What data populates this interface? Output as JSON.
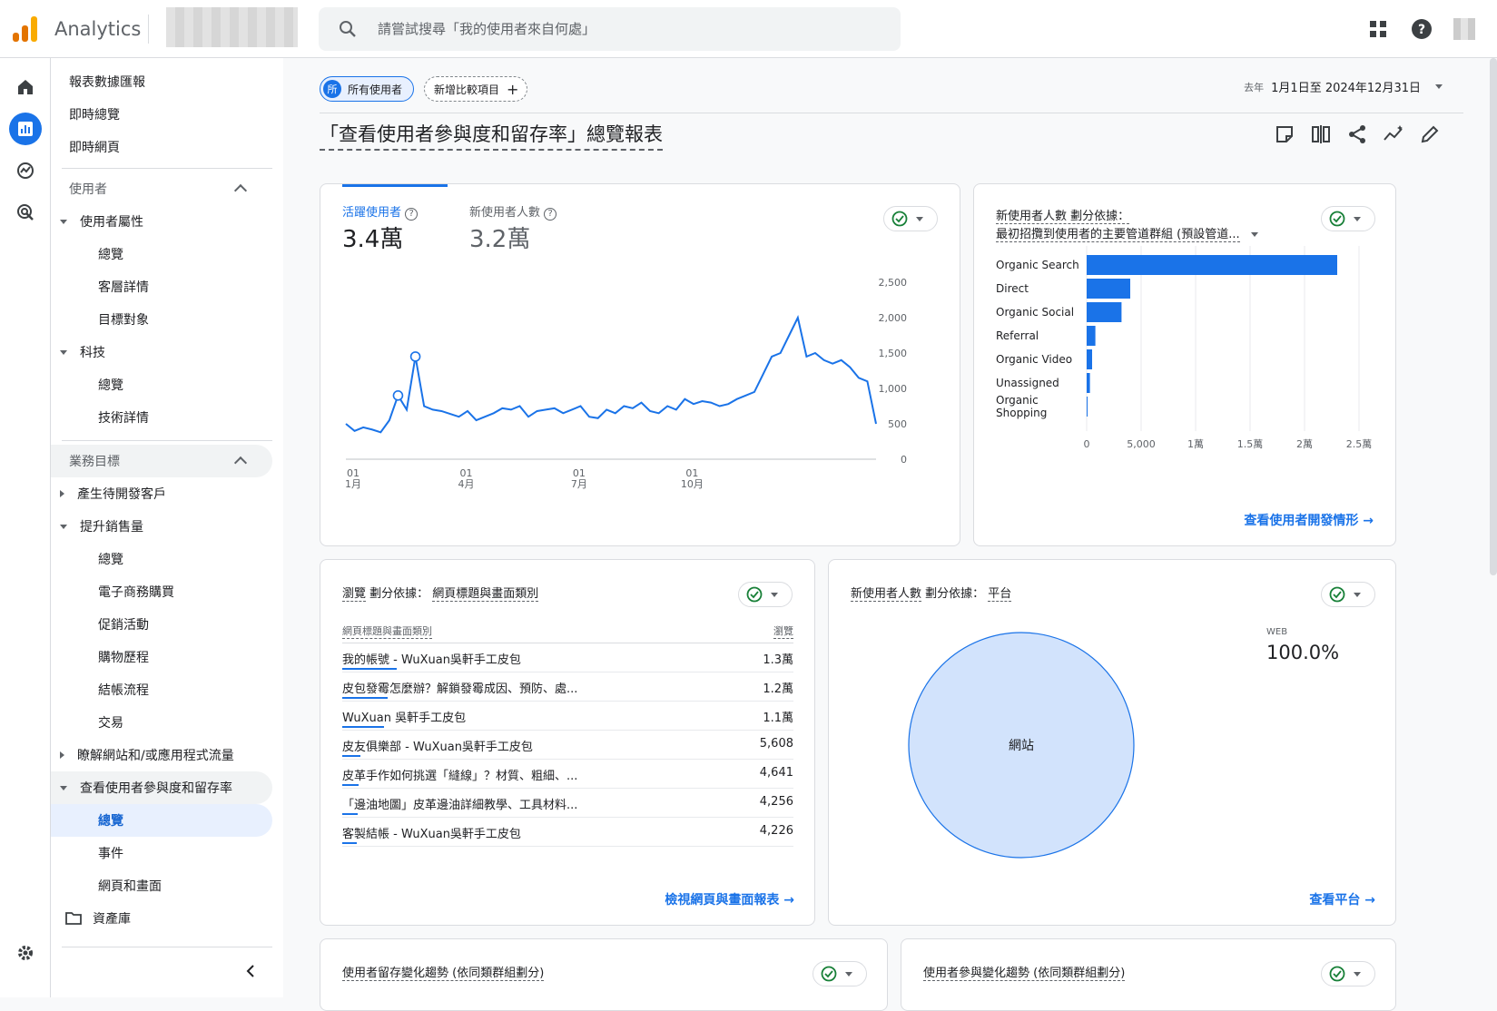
{
  "header": {
    "app_name": "Analytics",
    "search_placeholder": "請嘗試搜尋「我的使用者來自何處」"
  },
  "nav": {
    "items": [
      {
        "label": "報表數據匯報"
      },
      {
        "label": "即時總覽"
      },
      {
        "label": "即時網頁"
      }
    ],
    "section_users": "使用者",
    "user_attrs": "使用者屬性",
    "overview1": "總覽",
    "audience_detail": "客層詳情",
    "targets": "目標對象",
    "tech": "科技",
    "overview2": "總覽",
    "tech_detail": "技術詳情",
    "section_business": "業務目標",
    "leads": "產生待開發客戶",
    "sales": "提升銷售量",
    "overview3": "總覽",
    "ecom": "電子商務購買",
    "promo": "促銷活動",
    "purchase_path": "購物歷程",
    "checkout": "結帳流程",
    "transactions": "交易",
    "traffic": "瞭解網站和/或應用程式流量",
    "engagement": "查看使用者參與度和留存率",
    "overview4": "總覽",
    "events": "事件",
    "pages": "網頁和畫面",
    "library": "資產庫"
  },
  "filters": {
    "all_users_badge": "所",
    "all_users": "所有使用者",
    "add_compare": "新增比較項目",
    "add_icon": "+",
    "date_prefix": "去年",
    "date_range": "1月1日至 2024年12月31日"
  },
  "page_title": "「查看使用者參與度和留存率」總覽報表",
  "card_line": {
    "metric1_label": "活躍使用者",
    "metric1_value": "3.4萬",
    "metric2_label": "新使用者人數",
    "metric2_value": "3.2萬",
    "y_ticks": [
      "2,500",
      "2,000",
      "1,500",
      "1,000",
      "500",
      "0"
    ],
    "x_ticks": [
      {
        "day": "01",
        "month": "1月"
      },
      {
        "day": "01",
        "month": "4月"
      },
      {
        "day": "01",
        "month": "7月"
      },
      {
        "day": "01",
        "month": "10月"
      }
    ]
  },
  "card_channel": {
    "title_line1": "新使用者人數 劃分依據：",
    "title_line2": "最初招攬到使用者的主要管道群組 (預設管道...",
    "link": "查看使用者開發情形"
  },
  "card_pages": {
    "title_metric": "瀏覽",
    "title_mid": " 劃分依據： ",
    "title_dim": "網頁標題與畫面類別",
    "col_dim": "網頁標題與畫面類別",
    "col_metric": "瀏覽",
    "rows": [
      {
        "title": "我的帳號 - WuXuan吳軒手工皮包",
        "value": "1.3萬"
      },
      {
        "title": "皮包發霉怎麼辦？解鎖發霉成因、預防、處...",
        "value": "1.2萬"
      },
      {
        "title": "WuXuan 吳軒手工皮包",
        "value": "1.1萬"
      },
      {
        "title": "皮友俱樂部 - WuXuan吳軒手工皮包",
        "value": "5,608"
      },
      {
        "title": "皮革手作如何挑選「縫線」？材質、粗細、...",
        "value": "4,641"
      },
      {
        "title": "「邊油地圖」皮革邊油詳細教學、工具材料...",
        "value": "4,256"
      },
      {
        "title": "客製結帳 - WuXuan吳軒手工皮包",
        "value": "4,226"
      }
    ],
    "link": "檢視網頁與畫面報表"
  },
  "card_platform": {
    "title_metric": "新使用者人數",
    "title_mid": " 劃分依據： ",
    "title_dim": "平台",
    "legend_label": "WEB",
    "legend_value": "100.0%",
    "slice_label": "網站",
    "link": "查看平台"
  },
  "card_retention": {
    "title": "使用者留存變化趨勢 (依同類群組劃分)"
  },
  "card_engage_trend": {
    "title": "使用者參與變化趨勢 (依同類群組劃分)"
  },
  "chart_data": [
    {
      "type": "line",
      "title": "",
      "series": [
        {
          "name": "活躍使用者",
          "values": [
            500,
            400,
            450,
            420,
            380,
            550,
            900,
            700,
            1450,
            750,
            700,
            680,
            640,
            600,
            680,
            550,
            600,
            650,
            720,
            700,
            750,
            600,
            680,
            700,
            720,
            650,
            700,
            750,
            600,
            580,
            700,
            650,
            750,
            720,
            800,
            680,
            650,
            750,
            700,
            850,
            780,
            820,
            800,
            750,
            780,
            850,
            900,
            950,
            1200,
            1450,
            1500,
            1750,
            2000,
            1450,
            1500,
            1400,
            1350,
            1400,
            1300,
            1150,
            1100,
            500
          ]
        }
      ],
      "ylim": [
        0,
        2500
      ],
      "x_tick_labels": [
        "01 1月",
        "01 4月",
        "01 7月",
        "01 10月"
      ]
    },
    {
      "type": "bar",
      "orientation": "horizontal",
      "categories": [
        "Organic Search",
        "Direct",
        "Organic Social",
        "Referral",
        "Organic Video",
        "Unassigned",
        "Organic Shopping"
      ],
      "values": [
        23000,
        4000,
        3200,
        800,
        500,
        300,
        50
      ],
      "x_ticks": [
        "0",
        "5,000",
        "1萬",
        "1.5萬",
        "2萬",
        "2.5萬"
      ],
      "xlim": [
        0,
        25000
      ]
    },
    {
      "type": "pie",
      "categories": [
        "網站"
      ],
      "values": [
        100.0
      ]
    }
  ],
  "colors": {
    "accent": "#1a73e8",
    "pie_fill": "#d2e3fc",
    "pie_stroke": "#1a73e8"
  }
}
